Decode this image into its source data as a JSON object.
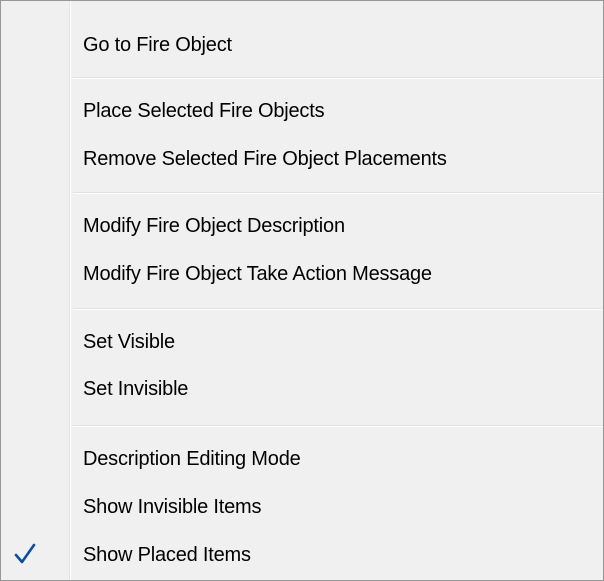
{
  "menu": {
    "items": [
      {
        "label": "Go to Fire Object"
      },
      {
        "label": "Place Selected Fire Objects"
      },
      {
        "label": "Remove Selected Fire Object Placements"
      },
      {
        "label": "Modify Fire Object Description"
      },
      {
        "label": "Modify Fire Object Take Action Message"
      },
      {
        "label": "Set Visible"
      },
      {
        "label": "Set Invisible"
      },
      {
        "label": "Description Editing Mode"
      },
      {
        "label": "Show Invisible Items"
      },
      {
        "label": "Show Placed Items",
        "checked": true
      }
    ],
    "check_icon": "check-icon",
    "colors": {
      "background": "#f0f0f0",
      "border": "#979797",
      "separator": "#e0e0e0",
      "check": "#0a4fa0"
    }
  }
}
